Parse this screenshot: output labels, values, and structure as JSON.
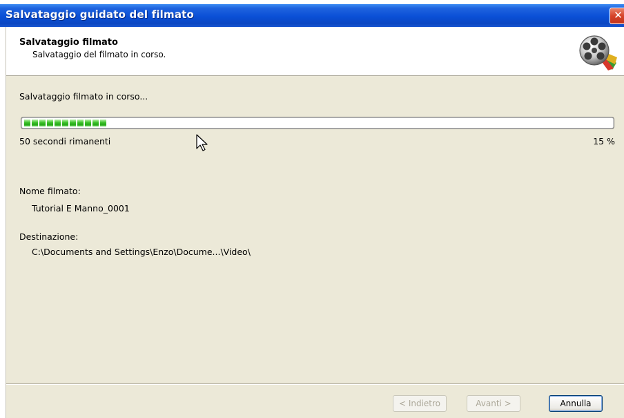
{
  "window": {
    "title": "Salvataggio guidato del filmato",
    "close_label": "✕"
  },
  "header": {
    "title": "Salvataggio filmato",
    "subtitle": "Salvataggio del filmato in corso."
  },
  "status": {
    "text": "Salvataggio filmato in corso...",
    "remaining": "50 secondi rimanenti",
    "percent_label": "15 %",
    "progress_fraction": 0.15,
    "progress_color": "#31c01f"
  },
  "details": {
    "name_label": "Nome filmato:",
    "name_value": "Tutorial E Manno_0001",
    "dest_label": "Destinazione:",
    "dest_value": "C:\\Documents and Settings\\Enzo\\Docume...\\Video\\"
  },
  "buttons": {
    "back": "< Indietro",
    "next": "Avanti >",
    "cancel": "Annulla"
  },
  "icons": {
    "header_icon": "film-reel-icon",
    "close": "close-icon",
    "cursor": "mouse-pointer-icon"
  }
}
